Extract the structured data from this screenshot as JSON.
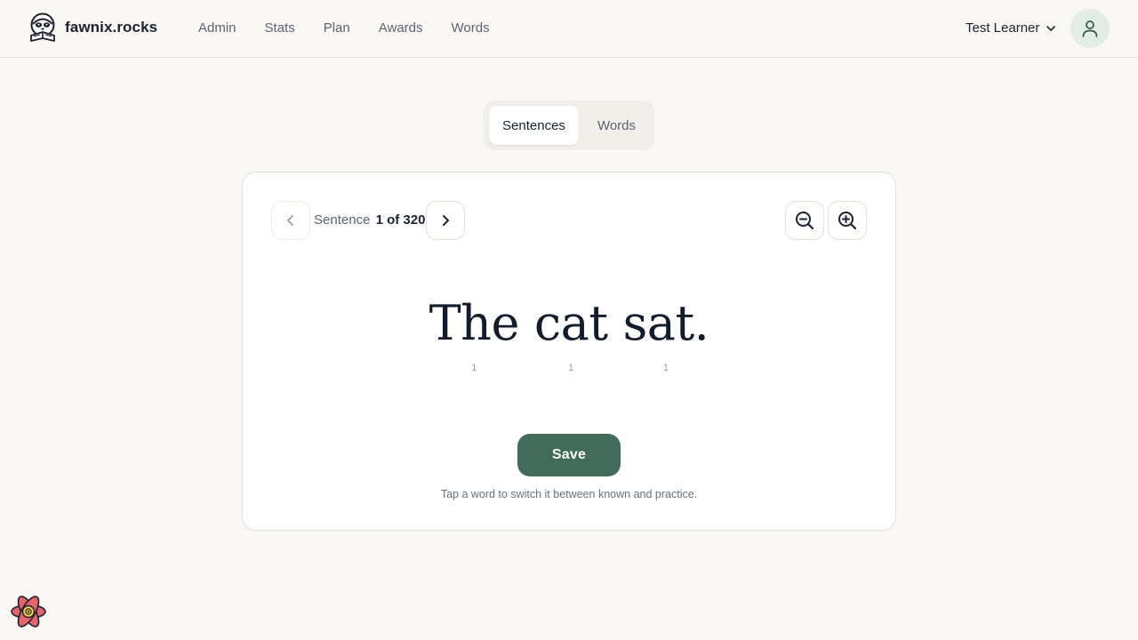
{
  "header": {
    "brand_name": "fawnix.rocks",
    "nav": [
      "Admin",
      "Stats",
      "Plan",
      "Awards",
      "Words"
    ],
    "user_name": "Test Learner"
  },
  "mode_tabs": {
    "sentences": "Sentences",
    "words": "Words",
    "active": "Sentences"
  },
  "card": {
    "counter_label": "Sentence",
    "counter_value": "1 of 320",
    "words": [
      {
        "text": "The",
        "count": "1"
      },
      {
        "text": "cat",
        "count": "1"
      },
      {
        "text": "sat.",
        "count": "1"
      }
    ],
    "save_label": "Save",
    "hint": "Tap a word to switch it between known and practice."
  },
  "colors": {
    "accent": "#416b5b",
    "background": "#f9f8f5",
    "avatar_bg": "#e4ece8"
  }
}
